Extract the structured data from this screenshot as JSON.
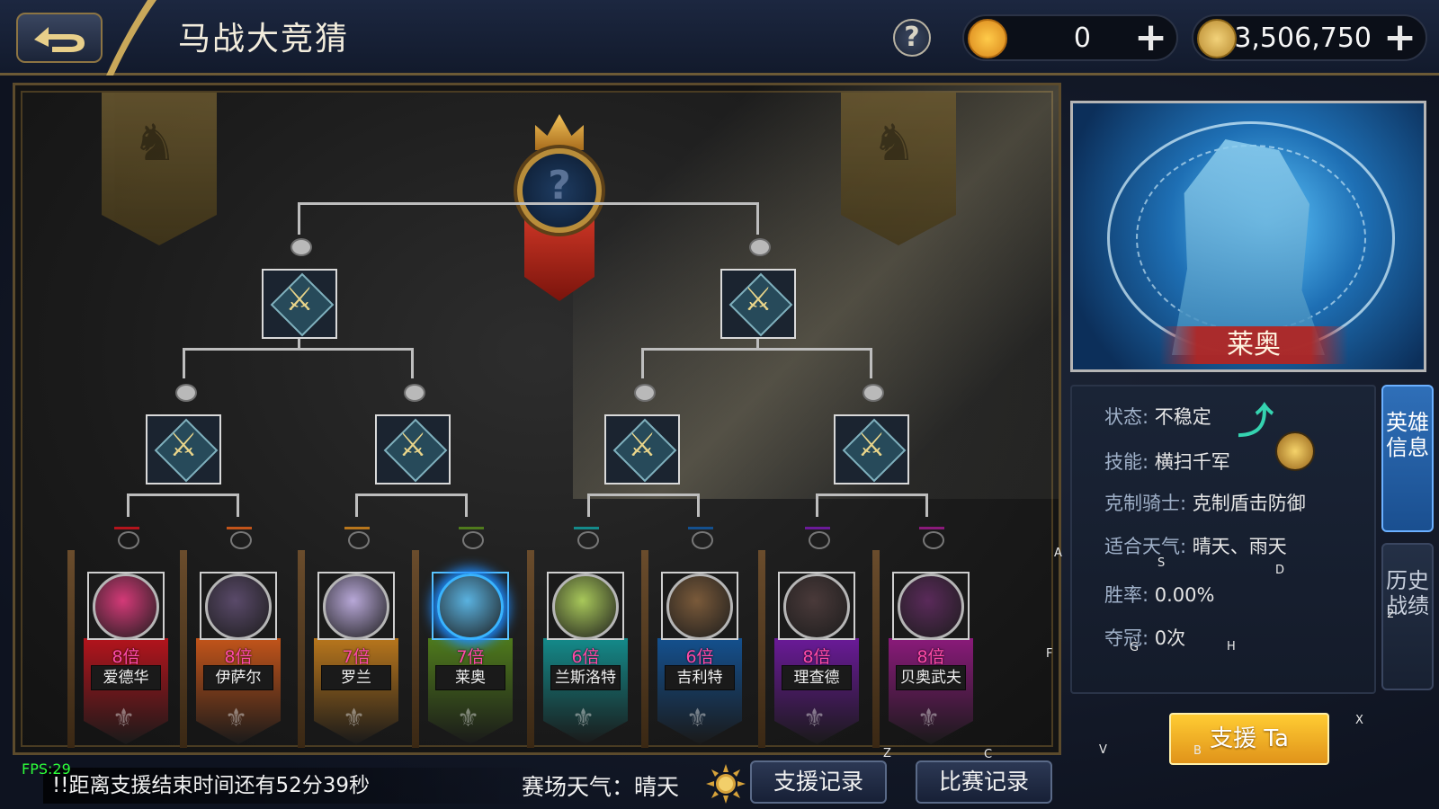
{
  "header": {
    "title": "马战大竞猜",
    "help_label": "?",
    "horse_coins": "0",
    "gold": "3,506,750",
    "plus_label": "+"
  },
  "bracket": {
    "heroes": [
      {
        "name": "爱德华",
        "odds": "8倍",
        "color": "#b3141c",
        "portrait_color": "#d43a78"
      },
      {
        "name": "伊萨尔",
        "odds": "8倍",
        "color": "#c2541a",
        "portrait_color": "#5a4a6a"
      },
      {
        "name": "罗兰",
        "odds": "7倍",
        "color": "#b8761c",
        "portrait_color": "#b8a8d8"
      },
      {
        "name": "莱奥",
        "odds": "7倍",
        "color": "#4f7a1c",
        "portrait_color": "#5ab2e0"
      },
      {
        "name": "兰斯洛特",
        "odds": "6倍",
        "color": "#148a8a",
        "portrait_color": "#a8c85a"
      },
      {
        "name": "吉利特",
        "odds": "6倍",
        "color": "#14508e",
        "portrait_color": "#7a5a3a"
      },
      {
        "name": "理查德",
        "odds": "8倍",
        "color": "#6a1a98",
        "portrait_color": "#4a3a3a"
      },
      {
        "name": "贝奥武夫",
        "odds": "8倍",
        "color": "#8a1a7a",
        "portrait_color": "#5a2a5a"
      }
    ],
    "crown_placeholder": "?"
  },
  "selected_hero": {
    "name": "莱奥",
    "status_label": "状态",
    "status_value": "不稳定",
    "skill_label": "技能",
    "skill_value": "横扫千军",
    "counter_label": "克制骑士",
    "counter_value": "克制盾击防御",
    "weather_label": "适合天气",
    "weather_value": "晴天、雨天",
    "winrate_label": "胜率",
    "winrate_value": "0.00%",
    "titles_label": "夺冠",
    "titles_value": "0次"
  },
  "tabs": {
    "hero_info": "英雄信息",
    "history": "历史战绩"
  },
  "support_button": "支援 Ta",
  "footer": {
    "countdown": "!!距离支援结束时间还有52分39秒",
    "fps": "FPS:29",
    "weather_label": "赛场天气：",
    "weather_value": "晴天",
    "support_record": "支援记录",
    "match_record": "比赛记录"
  },
  "debug_marks": [
    "A",
    "S",
    "D",
    "F",
    "G",
    "H",
    "Z",
    "X",
    "C",
    "V",
    "B",
    "2"
  ]
}
